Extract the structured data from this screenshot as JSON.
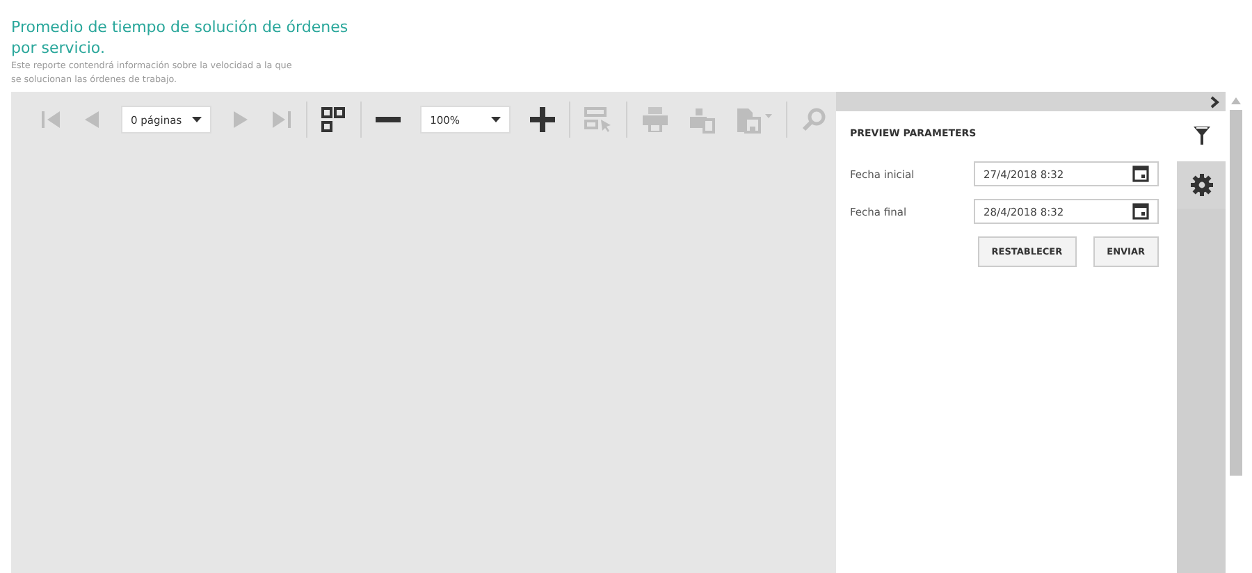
{
  "report": {
    "title": "Promedio de tiempo de solución de órdenes por servicio.",
    "description": "Este reporte contendrá información sobre la velocidad a la que se solucionan las órdenes de trabajo."
  },
  "toolbar": [
    {
      "kind": "button",
      "disabled": true
    },
    {
      "kind": "button",
      "disabled": true
    },
    {
      "kind": "dropdown",
      "value": "0 páginas"
    },
    {
      "kind": "button",
      "disabled": true
    },
    {
      "kind": "button",
      "disabled": true
    },
    {
      "kind": "separator"
    },
    {
      "kind": "button",
      "disabled": false
    },
    {
      "kind": "separator"
    },
    {
      "kind": "button",
      "disabled": false
    },
    {
      "kind": "dropdown",
      "value": "100%"
    },
    {
      "kind": "button",
      "disabled": false
    },
    {
      "kind": "separator"
    },
    {
      "kind": "button",
      "disabled": true
    },
    {
      "kind": "separator"
    },
    {
      "kind": "button",
      "disabled": true
    },
    {
      "kind": "button",
      "disabled": true
    },
    {
      "kind": "button",
      "disabled": true
    },
    {
      "kind": "separator"
    },
    {
      "kind": "button",
      "disabled": true
    }
  ],
  "panel": {
    "title": "PREVIEW PARAMETERS",
    "parameters": [
      {
        "label": "Fecha inicial",
        "value": "27/4/2018 8:32"
      },
      {
        "label": "Fecha final",
        "value": "28/4/2018 8:32"
      }
    ],
    "buttons": [
      "RESTABLECER",
      "ENVIAR"
    ]
  },
  "side_tabs": [
    {
      "selected": true
    },
    {
      "selected": false
    }
  ]
}
